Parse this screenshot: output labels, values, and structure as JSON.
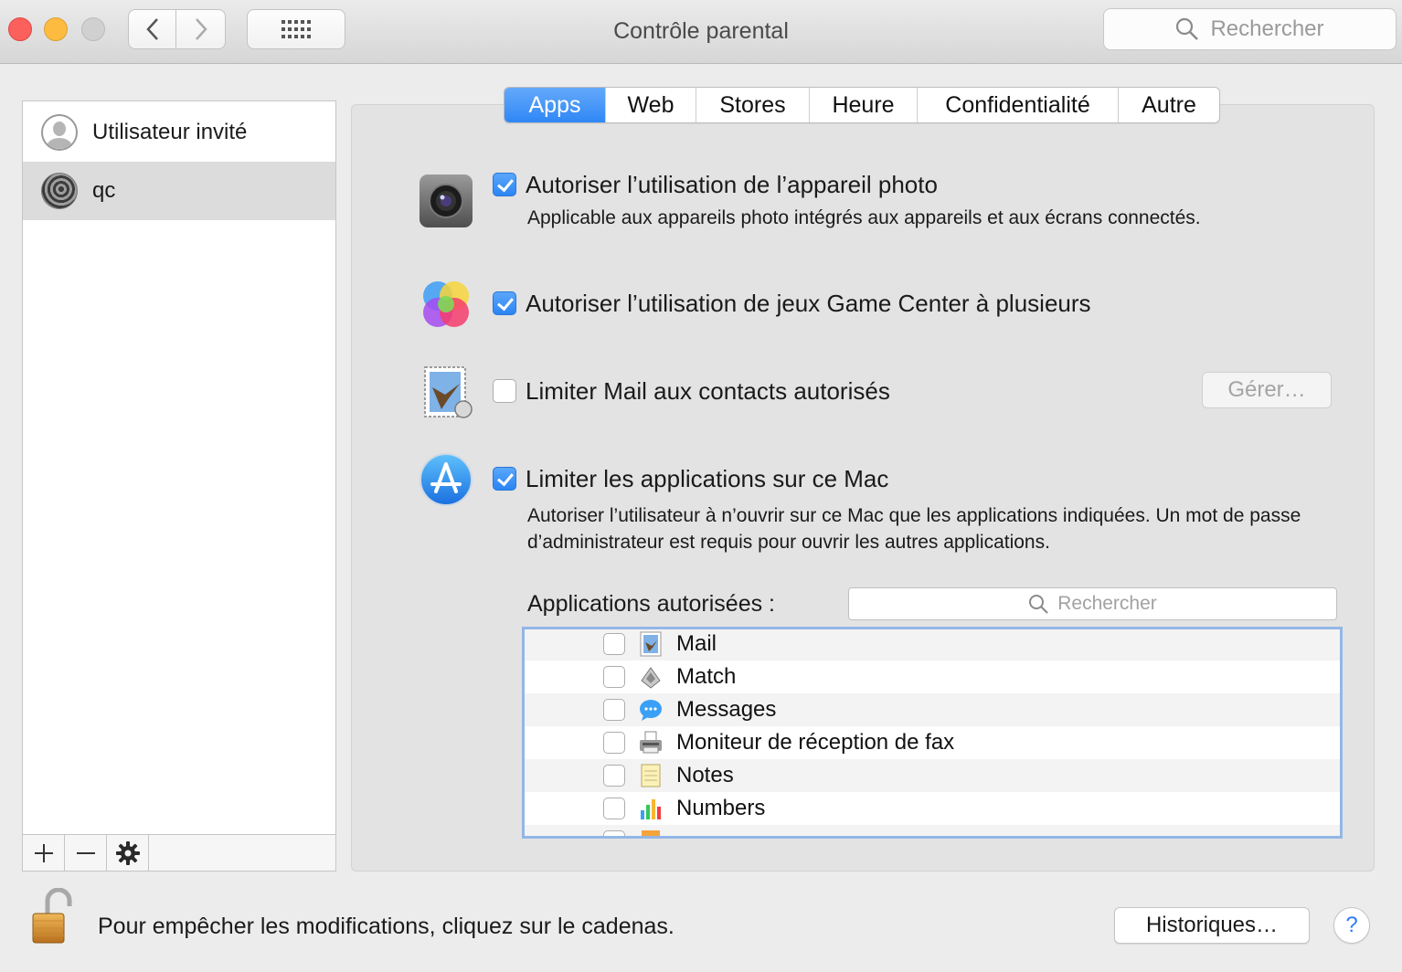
{
  "window": {
    "title": "Contrôle parental"
  },
  "toolbar": {
    "search_placeholder": "Rechercher"
  },
  "sidebar": {
    "users": [
      {
        "name": "Utilisateur invité",
        "avatar": "guest-avatar",
        "selected": false
      },
      {
        "name": "qc",
        "avatar": "fingerprint-avatar",
        "selected": true
      }
    ],
    "add_label": "+",
    "remove_label": "—"
  },
  "tabs": [
    {
      "label": "Apps",
      "active": true
    },
    {
      "label": "Web",
      "active": false
    },
    {
      "label": "Stores",
      "active": false
    },
    {
      "label": "Heure",
      "active": false
    },
    {
      "label": "Confidentialité",
      "active": false
    },
    {
      "label": "Autre",
      "active": false
    }
  ],
  "options": {
    "camera": {
      "label": "Autoriser l’utilisation de l’appareil photo",
      "checked": true,
      "description": "Applicable aux appareils photo intégrés aux appareils et aux écrans connectés."
    },
    "gamecenter": {
      "label": "Autoriser l’utilisation de jeux Game Center à plusieurs",
      "checked": true
    },
    "mail": {
      "label": "Limiter Mail aux contacts autorisés",
      "checked": false,
      "manage_label": "Gérer…"
    },
    "apps": {
      "label": "Limiter les applications sur ce Mac",
      "checked": true,
      "description": "Autoriser l’utilisateur à n’ouvrir sur ce Mac que les applications indiquées. Un mot de passe d’administrateur est requis pour ouvrir les autres applications."
    }
  },
  "allowed_apps": {
    "label": "Applications autorisées :",
    "search_placeholder": "Rechercher",
    "items": [
      {
        "name": "Mail",
        "checked": false,
        "icon": "mail-icon"
      },
      {
        "name": "Match",
        "checked": false,
        "icon": "match-icon"
      },
      {
        "name": "Messages",
        "checked": false,
        "icon": "messages-icon"
      },
      {
        "name": "Moniteur de réception de fax",
        "checked": false,
        "icon": "fax-icon"
      },
      {
        "name": "Notes",
        "checked": false,
        "icon": "notes-icon"
      },
      {
        "name": "Numbers",
        "checked": false,
        "icon": "numbers-icon"
      }
    ]
  },
  "footer": {
    "lock_text": "Pour empêcher les modifications, cliquez sur le cadenas.",
    "history_button": "Historiques…",
    "help_label": "?"
  },
  "colors": {
    "accent": "#2f87f6",
    "list_focus": "#93b6e6"
  }
}
